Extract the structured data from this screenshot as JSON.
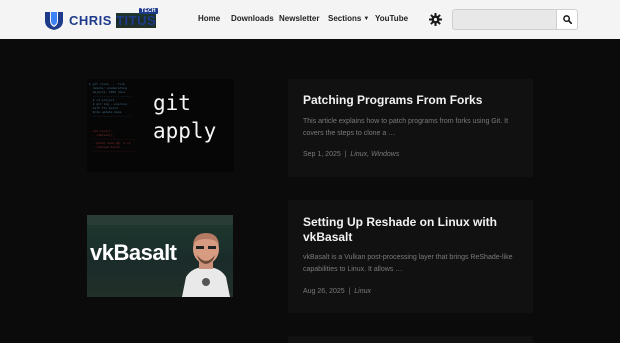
{
  "brand": {
    "name_part1": "CHRIS",
    "name_part2": "TITUS",
    "tag": "TECH"
  },
  "nav": {
    "items": [
      {
        "label": "Home"
      },
      {
        "label": "Downloads"
      },
      {
        "label": "Newsletter"
      },
      {
        "label": "Sections",
        "has_dropdown": true
      },
      {
        "label": "YouTube"
      }
    ]
  },
  "search": {
    "value": "",
    "placeholder": ""
  },
  "icons": {
    "theme_toggle": "gear-sun-icon",
    "search": "magnifier-icon"
  },
  "colors": {
    "header_bg": "#f4f4f4",
    "page_bg": "#0b0b0b",
    "card_bg": "#111111",
    "brand_blue": "#1e3a8a"
  },
  "posts": [
    {
      "thumb_text": "git\napply",
      "title": "Patching Programs From Forks",
      "excerpt": "This article explains how to patch programs from forks using Git. It covers the steps to clone a …",
      "date": "Sep 1, 2025",
      "categories": "Linux, Windows"
    },
    {
      "thumb_text": "vkBasalt",
      "title": "Setting Up Reshade on Linux with vkBasalt",
      "excerpt": "vkBasalt is a Vulkan post-processing layer that brings ReShade-like capabilities to Linux. It allows …",
      "date": "Aug 26, 2025",
      "categories": "Linux"
    }
  ]
}
